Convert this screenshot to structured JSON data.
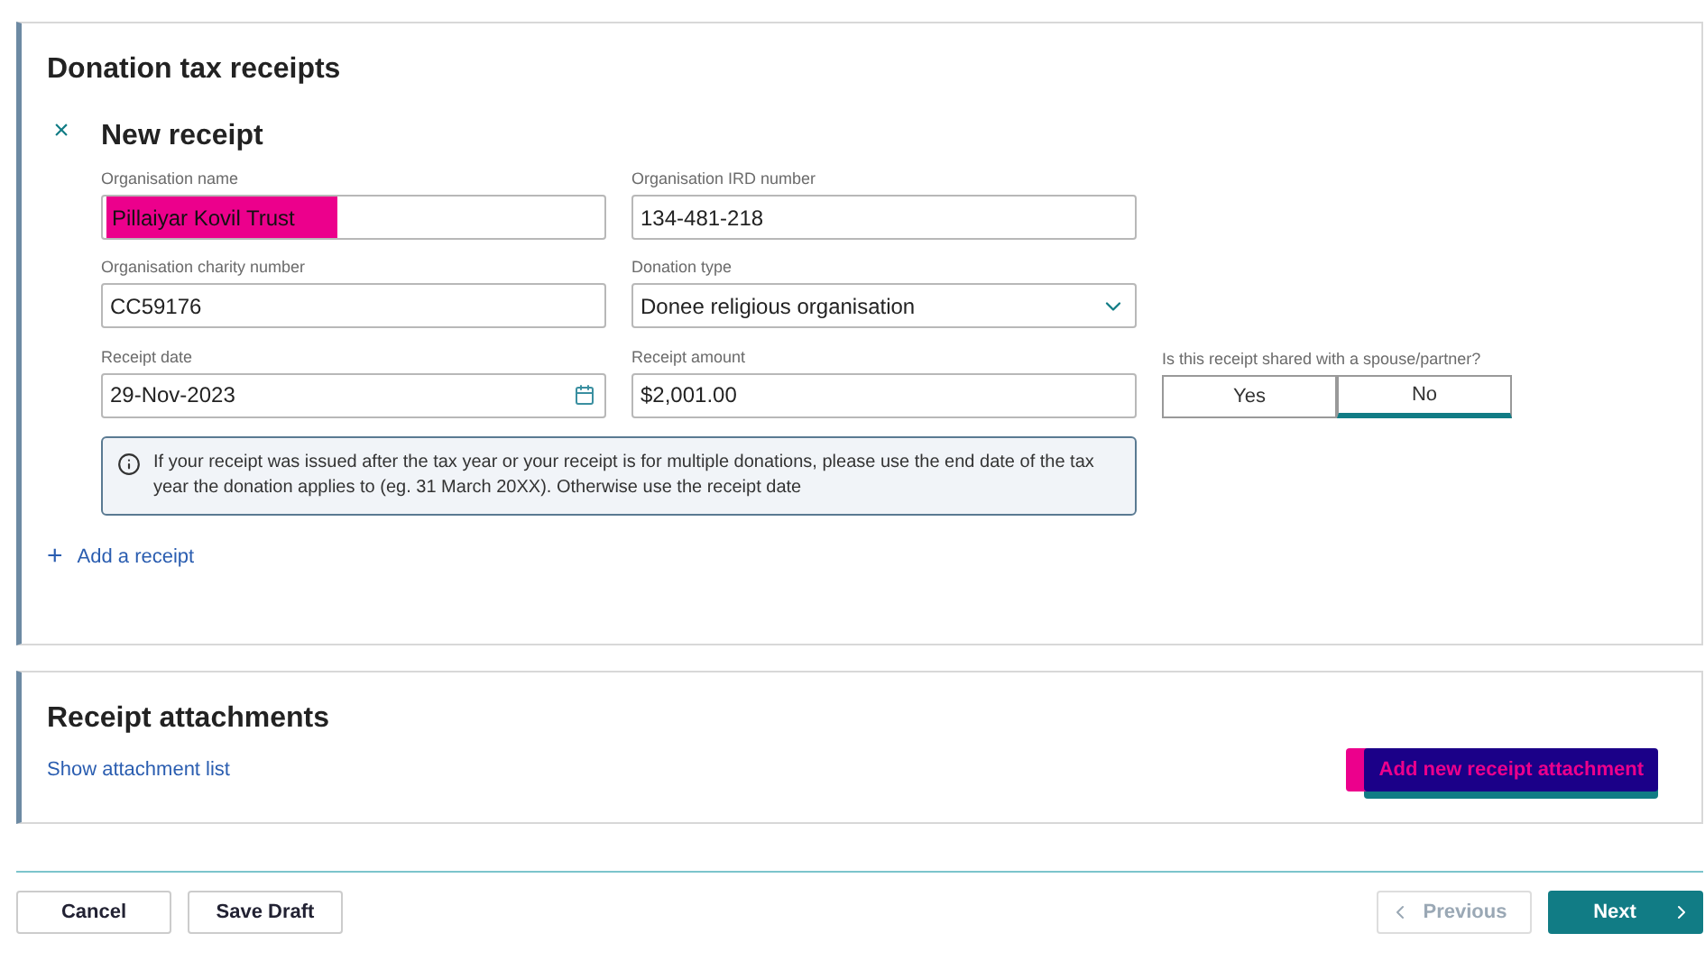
{
  "receipts_section": {
    "title": "Donation tax receipts",
    "close_icon": "×",
    "receipt": {
      "title": "New receipt",
      "fields": [
        {
          "kind": "text",
          "label": "Organisation name",
          "value": "Pillaiyar Kovil Trust",
          "highlighted": true
        },
        {
          "kind": "text",
          "label": "Organisation IRD number",
          "value": "134-481-218",
          "highlighted": false
        },
        {
          "kind": "text",
          "label": "Organisation charity number",
          "value": "CC59176",
          "highlighted": false
        },
        {
          "kind": "select",
          "label": "Donation type",
          "value": "Donee religious organisation",
          "highlighted": false
        },
        {
          "kind": "date",
          "label": "Receipt date",
          "value": "29-Nov-2023",
          "highlighted": false
        },
        {
          "kind": "text",
          "label": "Receipt amount",
          "value": "$2,001.00",
          "highlighted": false
        }
      ],
      "shared": {
        "label": "Is this receipt shared with a spouse/partner?",
        "options": [
          {
            "label": "Yes",
            "selected": false
          },
          {
            "label": "No",
            "selected": true
          }
        ]
      },
      "info": "If your receipt was issued after the tax year or your receipt is for multiple donations, please use the end date of the tax year the donation applies to (eg. 31 March 20XX). Otherwise use the receipt date"
    },
    "add_link": {
      "icon": "+",
      "label": "Add a receipt"
    }
  },
  "attachments_section": {
    "title": "Receipt attachments",
    "link": "Show attachment list",
    "button": {
      "label": "Add new receipt attachment",
      "highlighted": true
    }
  },
  "footer": {
    "buttons": [
      {
        "label": "Cancel"
      },
      {
        "label": "Save Draft"
      }
    ],
    "nav": [
      {
        "label": "Previous",
        "kind": "previous",
        "disabled": true
      },
      {
        "label": "Next",
        "kind": "next",
        "disabled": false
      }
    ]
  }
}
